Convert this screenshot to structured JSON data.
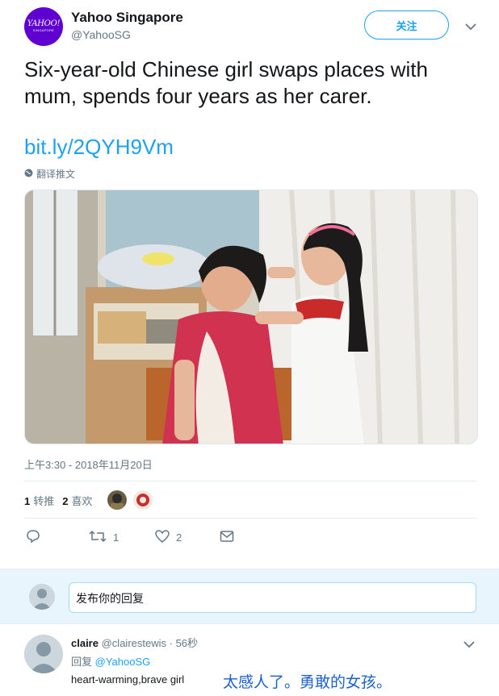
{
  "account": {
    "display_name": "Yahoo Singapore",
    "handle": "@YahooSG",
    "avatar_logo": "YAHOO!",
    "avatar_sub": "SINGAPORE",
    "brand_color": "#5f01d1"
  },
  "follow_label": "关注",
  "tweet": {
    "text": "Six-year-old Chinese girl swaps places with mum, spends four years as her carer.",
    "link": "bit.ly/2QYH9Vm",
    "translate_label": "翻译推文",
    "timestamp": "上午3:30 - 2018年11月20日"
  },
  "stats": {
    "retweets_count": "1",
    "retweets_label": "转推",
    "likes_count": "2",
    "likes_label": "喜欢"
  },
  "actions": {
    "reply_icon": "reply-icon",
    "retweet_count": "1",
    "like_count": "2",
    "dm_icon": "envelope-icon"
  },
  "composer": {
    "placeholder": "发布你的回复"
  },
  "reply": {
    "name": "claire",
    "handle": "@clairestewis",
    "time": "· 56秒",
    "reply_prefix": "回复",
    "reply_to": "@YahooSG",
    "text": "heart-warming,brave girl",
    "translation": "太感人了。勇敢的女孩。"
  },
  "colors": {
    "accent": "#1da1f2",
    "muted": "#657786",
    "text": "#14171a"
  }
}
